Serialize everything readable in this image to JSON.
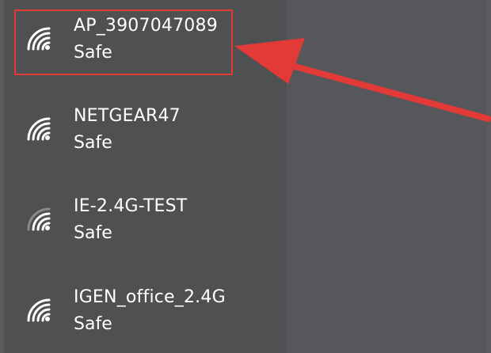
{
  "networks": [
    {
      "name": "AP_3907047089",
      "status": "Safe"
    },
    {
      "name": "NETGEAR47",
      "status": "Safe"
    },
    {
      "name": "IE-2.4G-TEST",
      "status": "Safe"
    },
    {
      "name": "IGEN_office_2.4G",
      "status": "Safe"
    }
  ],
  "colors": {
    "background": "#4f5052",
    "text": "#ffffff",
    "highlight": "#e13a37",
    "icon": "#ffffff"
  },
  "icons": [
    "wifi-signal-icon"
  ]
}
